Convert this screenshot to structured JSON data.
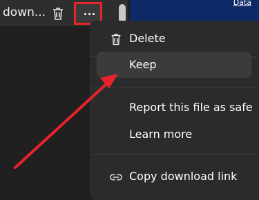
{
  "download": {
    "filename": "down...",
    "delete_icon": "trash-icon",
    "more_icon": "more-options-icon"
  },
  "page": {
    "link_text": "Data"
  },
  "menu": {
    "items": [
      {
        "label": "Delete",
        "icon": "trash-icon"
      },
      {
        "label": "Keep"
      },
      {
        "label": "Report this file as safe"
      },
      {
        "label": "Learn more"
      },
      {
        "label": "Copy download link",
        "icon": "link-icon"
      }
    ]
  },
  "annotation": {
    "color": "#e8232a",
    "target": "Keep"
  }
}
